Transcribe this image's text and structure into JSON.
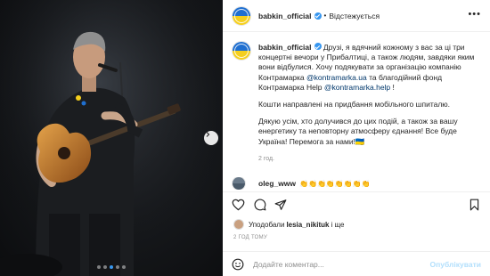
{
  "post": {
    "username": "babkin_official",
    "separator": "•",
    "follow_label": "Відстежується",
    "more_label": "•••"
  },
  "caption": {
    "username": "babkin_official",
    "p1_before": "Друзі, я вдячний кожному з вас за ці три концертні вечори у Прибалтиці, а також людям, завдяки яким вони відбулися. Хочу подякувати за організацію компанію Контрамарка ",
    "mention1": "@kontramarka.ua",
    "p1_middle": " та благодійний фонд Контрамарка Help ",
    "mention2": "@kontramarka.help",
    "p1_end": " !",
    "p2": "Кошти направлені на придбання мобільного шпиталю.",
    "p3": "Дякую усім, хто долучився до цих подій, а також за вашу енергетику та неповторну атмосферу єднання! Все буде Україна! Перемога за нами!🇺🇦",
    "time": "2 год."
  },
  "comment": {
    "username": "oleg_www",
    "text": "👏👏👏👏👏👏👏👏"
  },
  "likes": {
    "prefix": "Уподобали",
    "user": "lesia_nikituk",
    "suffix": "і ще"
  },
  "posted_ago": "2 ГОД ТОМУ",
  "comment_input": {
    "placeholder": "Додайте коментар...",
    "publish_label": "Опублікувати"
  },
  "carousel": {
    "total": 5,
    "active_index": 2
  },
  "icons": {
    "like": "heart-icon",
    "comment": "comment-icon",
    "share": "share-icon",
    "save": "bookmark-icon",
    "emoji": "smiley-icon",
    "next": "chevron-right-icon"
  },
  "colors": {
    "accent": "#3897f0",
    "link": "#00376b",
    "muted": "#8e8e8e",
    "publish_disabled": "#b2dffc"
  }
}
